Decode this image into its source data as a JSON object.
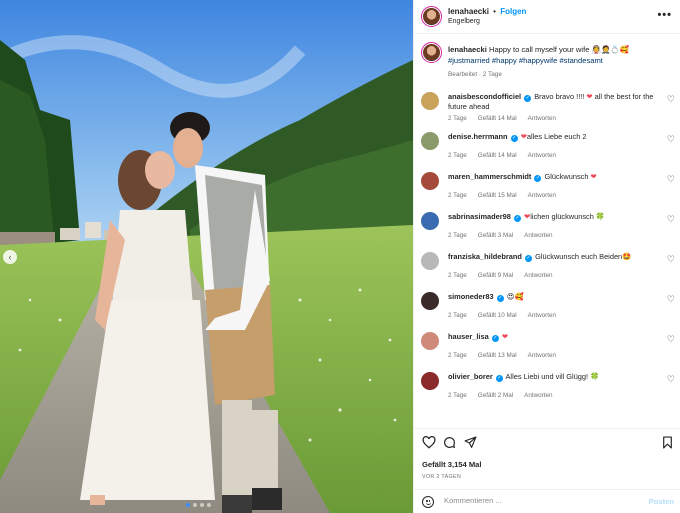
{
  "post": {
    "username": "lenahaecki",
    "separator": "•",
    "follow_label": "Folgen",
    "location": "Engelberg",
    "more_label": "•••",
    "caption_text": "Happy to call myself your wife 👰🤵💍🥰",
    "hashtags": "#justmarried #happy #happywife #standesamt",
    "edited": "Bearbeitet · 2 Tage"
  },
  "comments": [
    {
      "user": "anaisbescondofficiel",
      "text": "Bravo bravo !!!! ",
      "emoji": "❤",
      "emoji_kind": "heart",
      "text2": " all the best for the future ahead",
      "age": "2 Tage",
      "likes": "Gefällt 14 Mal",
      "reply": "Antworten",
      "avatar_color": "#c9a35a"
    },
    {
      "user": "denise.herrmann",
      "text": "",
      "emoji": "❤",
      "emoji_kind": "heart",
      "text2": "alles Liebe euch 2",
      "age": "2 Tage",
      "likes": "Gefällt 14 Mal",
      "reply": "Antworten",
      "avatar_color": "#8a9a6a"
    },
    {
      "user": "maren_hammerschmidt",
      "text": "Glückwunsch ",
      "emoji": "❤",
      "emoji_kind": "heart",
      "text2": "",
      "age": "2 Tage",
      "likes": "Gefällt 15 Mal",
      "reply": "Antworten",
      "avatar_color": "#a54a3a"
    },
    {
      "user": "sabrinasimader98",
      "text": "",
      "emoji": "❤",
      "emoji_kind": "heart",
      "text2": "lichen glückwunsch 🍀",
      "age": "2 Tage",
      "likes": "Gefällt 3 Mal",
      "reply": "Antworten",
      "avatar_color": "#3a6ab0"
    },
    {
      "user": "franziska_hildebrand",
      "text": "Glückwunsch euch Beiden",
      "emoji": "🤩",
      "emoji_kind": "emoji",
      "text2": "",
      "age": "2 Tage",
      "likes": "Gefällt 9 Mal",
      "reply": "Antworten",
      "avatar_color": "#b8b8b8"
    },
    {
      "user": "simoneder83",
      "text": "",
      "emoji": "😍🥰",
      "emoji_kind": "emoji",
      "text2": "",
      "age": "2 Tage",
      "likes": "Gefällt 10 Mal",
      "reply": "Antworten",
      "avatar_color": "#3a2a2a"
    },
    {
      "user": "hauser_lisa",
      "text": "",
      "emoji": "❤",
      "emoji_kind": "heart",
      "text2": "",
      "age": "2 Tage",
      "likes": "Gefällt 13 Mal",
      "reply": "Antworten",
      "avatar_color": "#d08a7a"
    },
    {
      "user": "olivier_borer",
      "text": "Alles Liebi und vill Glügg! ",
      "emoji": "🍀",
      "emoji_kind": "clover",
      "text2": "",
      "age": "2 Tage",
      "likes": "Gefällt 2 Mal",
      "reply": "Antworten",
      "avatar_color": "#8a2a2a"
    }
  ],
  "actions": {
    "likes": "Gefällt 3,154 Mal",
    "ago": "VOR 2 TAGEN",
    "comment_placeholder": "Kommentieren ...",
    "post_label": "Posten"
  },
  "icons": {
    "prev": "chevron-left-icon",
    "like": "heart-icon",
    "comment": "comment-icon",
    "share": "paper-plane-icon",
    "save": "bookmark-icon",
    "emoji": "emoji-icon"
  },
  "colors": {
    "link_blue": "#0095f6",
    "hashtag": "#00376b",
    "heart_red": "#ed4956",
    "muted": "#737373"
  },
  "carousel": {
    "current_index": 1,
    "total": 4
  }
}
